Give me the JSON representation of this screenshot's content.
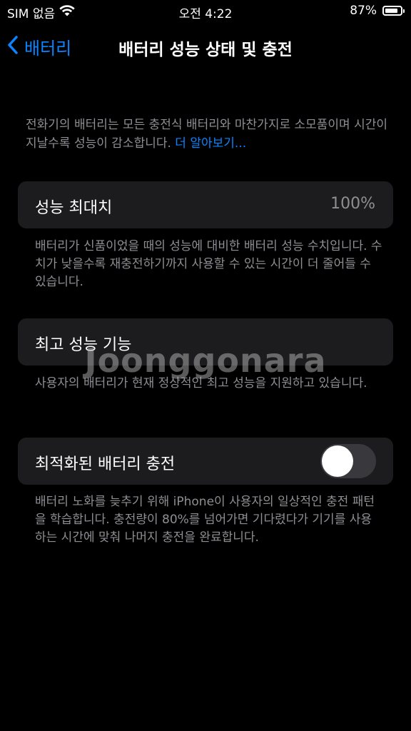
{
  "status_bar": {
    "carrier": "SIM 없음",
    "time": "오전 4:22",
    "battery_percent": "87%",
    "battery_level": 0.87
  },
  "nav": {
    "back_label": "배터리",
    "title": "배터리 성능 상태 및 충전"
  },
  "intro": {
    "text": "전화기의 배터리는 모든 충전식 배터리와 마찬가지로 소모품이며 시간이 지날수록 성능이 감소합니다. ",
    "learn_more": "더 알아보기..."
  },
  "max_capacity": {
    "label": "성능 최대치",
    "value": "100%",
    "footnote": "배터리가 신품이었을 때의 성능에 대비한 배터리 성능 수치입니다. 수치가 낮을수록 재충전하기까지 사용할 수 있는 시간이 더 줄어들 수 있습니다."
  },
  "peak_performance": {
    "label": "최고 성능 기능",
    "footnote": "사용자의 배터리가 현재 정상적인 최고 성능을 지원하고 있습니다."
  },
  "optimized_charging": {
    "label": "최적화된 배터리 충전",
    "enabled": false,
    "footnote": "배터리 노화를 늦추기 위해 iPhone이 사용자의 일상적인 충전 패턴을 학습합니다. 충전량이 80%를 넘어가면 기다렸다가 기기를 사용하는 시간에 맞춰 나머지 충전을 완료합니다."
  },
  "watermark": "Joonggonara",
  "colors": {
    "accent": "#0a84ff",
    "background": "#000000",
    "cell": "#1c1c1e",
    "secondary_text": "#8e8e93",
    "toggle_off": "#39393d"
  }
}
